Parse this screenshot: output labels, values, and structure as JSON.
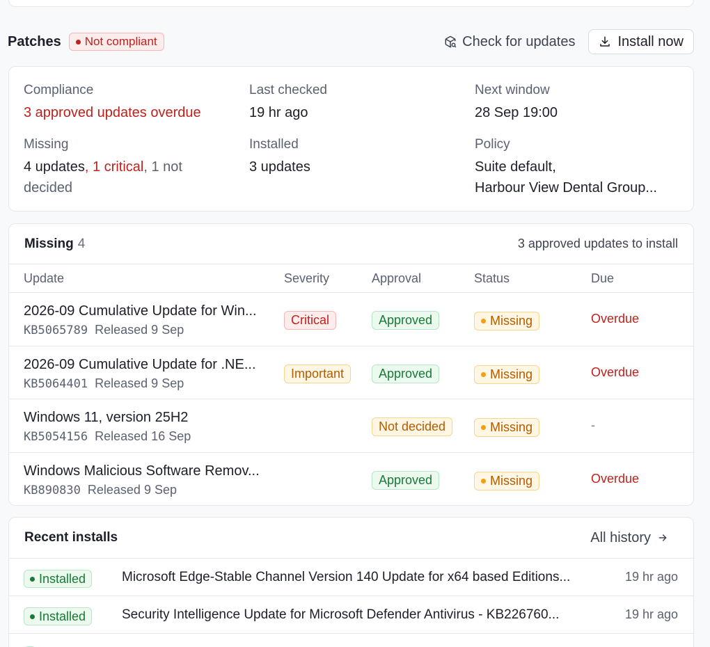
{
  "header": {
    "title": "Patches",
    "compliance_badge": "Not compliant",
    "check_updates_label": "Check for updates",
    "install_now_label": "Install now"
  },
  "summary": {
    "compliance_label": "Compliance",
    "compliance_value": "3 approved updates overdue",
    "last_checked_label": "Last checked",
    "last_checked_value": "19 hr ago",
    "next_window_label": "Next window",
    "next_window_value": "28 Sep 19:00",
    "missing_label": "Missing",
    "missing_updates": "4 updates",
    "missing_critical": "1 critical",
    "missing_not_decided_line1": "1 not",
    "missing_not_decided_line2": "decided",
    "installed_label": "Installed",
    "installed_value": "3 updates",
    "policy_label": "Policy",
    "policy_line1": "Suite default,",
    "policy_line2": "Harbour View Dental Group..."
  },
  "missing": {
    "title": "Missing",
    "count": "4",
    "summary": "3 approved updates to install",
    "columns": [
      "Update",
      "Severity",
      "Approval",
      "Status",
      "Due"
    ],
    "rows": [
      {
        "title": "2026-09 Cumulative Update for Win...",
        "kb": "KB5065789",
        "released": "Released 9 Sep",
        "severity": "Critical",
        "approval": "Approved",
        "status": "Missing",
        "due": "Overdue"
      },
      {
        "title": "2026-09 Cumulative Update for .NE...",
        "kb": "KB5064401",
        "released": "Released 9 Sep",
        "severity": "Important",
        "approval": "Approved",
        "status": "Missing",
        "due": "Overdue"
      },
      {
        "title": "Windows 11, version 25H2",
        "kb": "KB5054156",
        "released": "Released 16 Sep",
        "severity": "",
        "approval": "Not decided",
        "status": "Missing",
        "due": "-"
      },
      {
        "title": "Windows Malicious Software Remov...",
        "kb": "KB890830",
        "released": "Released 9 Sep",
        "severity": "",
        "approval": "Approved",
        "status": "Missing",
        "due": "Overdue"
      }
    ]
  },
  "recent": {
    "title": "Recent installs",
    "all_history_label": "All history",
    "rows": [
      {
        "status": "Installed",
        "name": "Microsoft Edge-Stable Channel Version 140 Update for x64 based Editions...",
        "time": "19 hr ago"
      },
      {
        "status": "Installed",
        "name": "Security Intelligence Update for Microsoft Defender Antivirus - KB226760...",
        "time": "19 hr ago"
      }
    ]
  },
  "colors": {
    "danger": "#c0211b",
    "warning": "#b35c00",
    "success": "#177a35"
  }
}
